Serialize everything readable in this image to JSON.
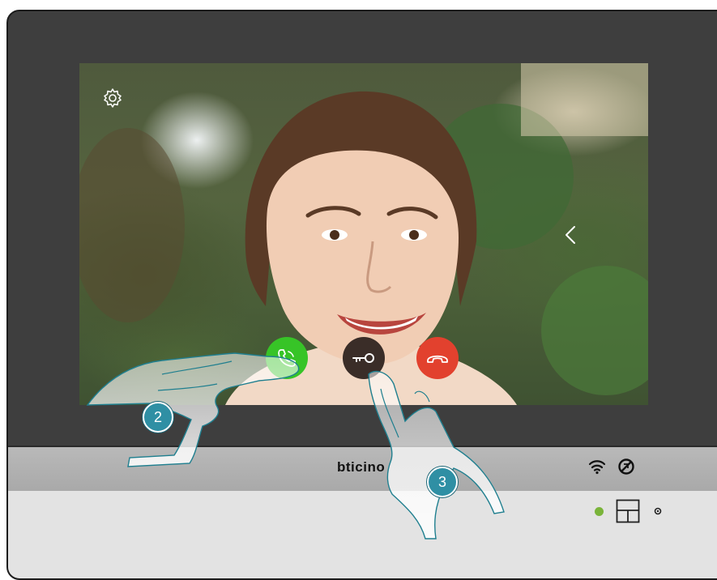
{
  "device": {
    "brand": "bticino",
    "status_icons": [
      "wifi-icon",
      "mute-icon"
    ],
    "led_color": "#7ab43a"
  },
  "screen": {
    "settings_icon": "gear-icon",
    "nav_icon": "chevron-left-icon",
    "buttons": [
      {
        "name": "answer-call-button",
        "icon": "phone-icon",
        "color": "#37c427"
      },
      {
        "name": "door-lock-button",
        "icon": "key-icon",
        "color": "#3a2d28"
      },
      {
        "name": "end-call-button",
        "icon": "hangup-icon",
        "color": "#e2412e"
      }
    ]
  },
  "steps": {
    "step_answer": "2",
    "step_door": "3"
  }
}
